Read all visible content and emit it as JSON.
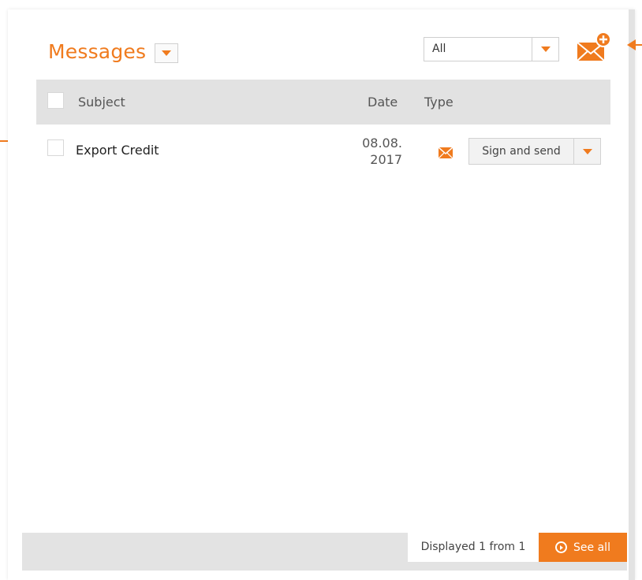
{
  "header": {
    "title": "Messages",
    "filter_value": "All",
    "icons": {
      "title_dropdown": "chevron-down-icon",
      "filter_dropdown": "chevron-down-icon",
      "new_message": "envelope-plus-icon"
    }
  },
  "table": {
    "columns": [
      "Subject",
      "Date",
      "Type"
    ],
    "rows": [
      {
        "subject": "Export Credit",
        "date_line1": "08.08.",
        "date_line2": "2017",
        "type_icon": "envelope-icon",
        "action": "Sign and send"
      }
    ]
  },
  "footer": {
    "displayed": "Displayed 1 from 1",
    "see_all": "See all",
    "see_all_icon": "play-circle-icon"
  },
  "colors": {
    "accent": "#f07b1e",
    "header_bg": "#e2e2e2",
    "footer_bg": "#e3e3e3"
  }
}
